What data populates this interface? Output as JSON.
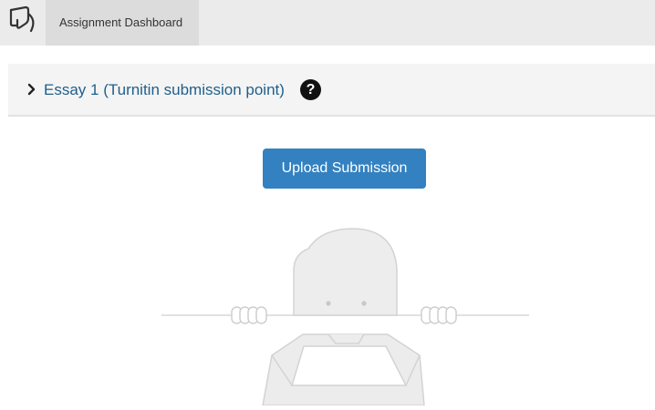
{
  "header": {
    "logo_icon": "turnitin-logo-icon",
    "tab_label": "Assignment Dashboard"
  },
  "assignment": {
    "title": "Essay 1 (Turnitin submission point)",
    "expand_icon": "chevron-right-icon",
    "help_icon": "question-circle-icon",
    "help_glyph": "?"
  },
  "actions": {
    "upload_label": "Upload Submission"
  },
  "colors": {
    "title_link": "#1f5f8b",
    "button": "#3381c0",
    "topbar": "#ebebeb",
    "tab_active": "#dcdcdc"
  },
  "illustration": {
    "icon": "empty-inbox-character-illustration"
  }
}
